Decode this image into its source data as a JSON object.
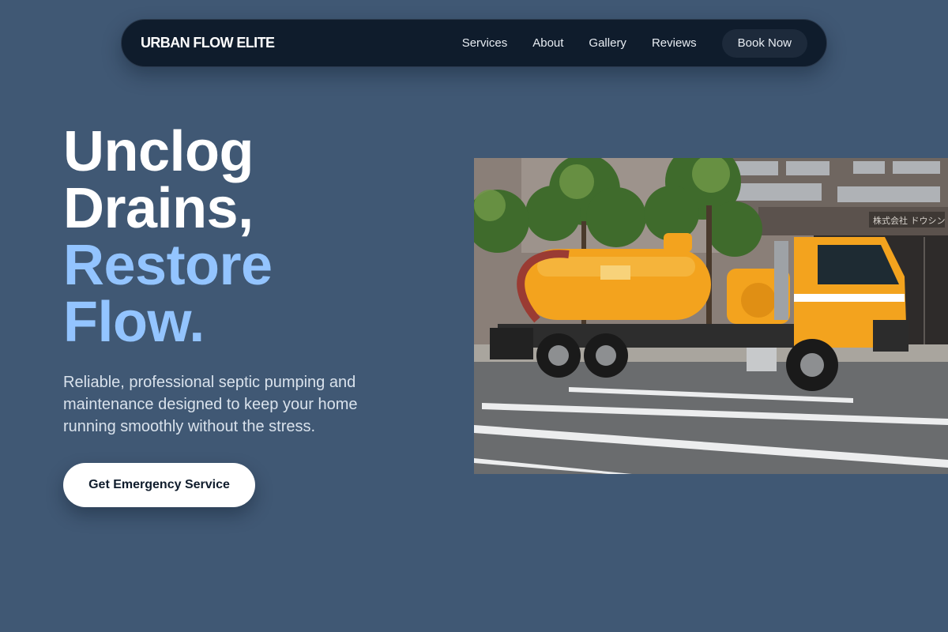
{
  "nav": {
    "brand": "URBAN FLOW ELITE",
    "links": [
      {
        "label": "Services"
      },
      {
        "label": "About"
      },
      {
        "label": "Gallery"
      },
      {
        "label": "Reviews"
      }
    ],
    "cta_label": "Book Now"
  },
  "hero": {
    "title_line1": "Unclog",
    "title_line2": "Drains,",
    "title_accent_line1": "Restore",
    "title_accent_line2": "Flow.",
    "subtitle": "Reliable, professional septic pumping and maintenance designed to keep your home running smoothly without the stress.",
    "cta_label": "Get Emergency Service",
    "image_alt": "Orange septic vacuum truck parked on a city street"
  },
  "colors": {
    "background": "#405874",
    "nav_background": "#0f1c2c",
    "accent": "#93c4ff",
    "cta_background": "#ffffff",
    "cta_text": "#0f1c2c"
  }
}
